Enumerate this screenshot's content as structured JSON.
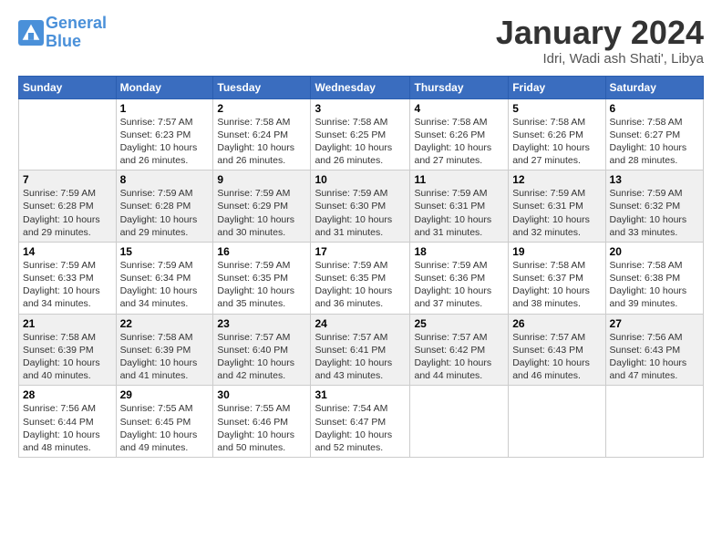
{
  "header": {
    "logo_line1": "General",
    "logo_line2": "Blue",
    "month_year": "January 2024",
    "location": "Idri, Wadi ash Shati', Libya"
  },
  "days_of_week": [
    "Sunday",
    "Monday",
    "Tuesday",
    "Wednesday",
    "Thursday",
    "Friday",
    "Saturday"
  ],
  "weeks": [
    [
      {
        "num": "",
        "info": ""
      },
      {
        "num": "1",
        "info": "Sunrise: 7:57 AM\nSunset: 6:23 PM\nDaylight: 10 hours\nand 26 minutes."
      },
      {
        "num": "2",
        "info": "Sunrise: 7:58 AM\nSunset: 6:24 PM\nDaylight: 10 hours\nand 26 minutes."
      },
      {
        "num": "3",
        "info": "Sunrise: 7:58 AM\nSunset: 6:25 PM\nDaylight: 10 hours\nand 26 minutes."
      },
      {
        "num": "4",
        "info": "Sunrise: 7:58 AM\nSunset: 6:26 PM\nDaylight: 10 hours\nand 27 minutes."
      },
      {
        "num": "5",
        "info": "Sunrise: 7:58 AM\nSunset: 6:26 PM\nDaylight: 10 hours\nand 27 minutes."
      },
      {
        "num": "6",
        "info": "Sunrise: 7:58 AM\nSunset: 6:27 PM\nDaylight: 10 hours\nand 28 minutes."
      }
    ],
    [
      {
        "num": "7",
        "info": "Sunrise: 7:59 AM\nSunset: 6:28 PM\nDaylight: 10 hours\nand 29 minutes."
      },
      {
        "num": "8",
        "info": "Sunrise: 7:59 AM\nSunset: 6:28 PM\nDaylight: 10 hours\nand 29 minutes."
      },
      {
        "num": "9",
        "info": "Sunrise: 7:59 AM\nSunset: 6:29 PM\nDaylight: 10 hours\nand 30 minutes."
      },
      {
        "num": "10",
        "info": "Sunrise: 7:59 AM\nSunset: 6:30 PM\nDaylight: 10 hours\nand 31 minutes."
      },
      {
        "num": "11",
        "info": "Sunrise: 7:59 AM\nSunset: 6:31 PM\nDaylight: 10 hours\nand 31 minutes."
      },
      {
        "num": "12",
        "info": "Sunrise: 7:59 AM\nSunset: 6:31 PM\nDaylight: 10 hours\nand 32 minutes."
      },
      {
        "num": "13",
        "info": "Sunrise: 7:59 AM\nSunset: 6:32 PM\nDaylight: 10 hours\nand 33 minutes."
      }
    ],
    [
      {
        "num": "14",
        "info": "Sunrise: 7:59 AM\nSunset: 6:33 PM\nDaylight: 10 hours\nand 34 minutes."
      },
      {
        "num": "15",
        "info": "Sunrise: 7:59 AM\nSunset: 6:34 PM\nDaylight: 10 hours\nand 34 minutes."
      },
      {
        "num": "16",
        "info": "Sunrise: 7:59 AM\nSunset: 6:35 PM\nDaylight: 10 hours\nand 35 minutes."
      },
      {
        "num": "17",
        "info": "Sunrise: 7:59 AM\nSunset: 6:35 PM\nDaylight: 10 hours\nand 36 minutes."
      },
      {
        "num": "18",
        "info": "Sunrise: 7:59 AM\nSunset: 6:36 PM\nDaylight: 10 hours\nand 37 minutes."
      },
      {
        "num": "19",
        "info": "Sunrise: 7:58 AM\nSunset: 6:37 PM\nDaylight: 10 hours\nand 38 minutes."
      },
      {
        "num": "20",
        "info": "Sunrise: 7:58 AM\nSunset: 6:38 PM\nDaylight: 10 hours\nand 39 minutes."
      }
    ],
    [
      {
        "num": "21",
        "info": "Sunrise: 7:58 AM\nSunset: 6:39 PM\nDaylight: 10 hours\nand 40 minutes."
      },
      {
        "num": "22",
        "info": "Sunrise: 7:58 AM\nSunset: 6:39 PM\nDaylight: 10 hours\nand 41 minutes."
      },
      {
        "num": "23",
        "info": "Sunrise: 7:57 AM\nSunset: 6:40 PM\nDaylight: 10 hours\nand 42 minutes."
      },
      {
        "num": "24",
        "info": "Sunrise: 7:57 AM\nSunset: 6:41 PM\nDaylight: 10 hours\nand 43 minutes."
      },
      {
        "num": "25",
        "info": "Sunrise: 7:57 AM\nSunset: 6:42 PM\nDaylight: 10 hours\nand 44 minutes."
      },
      {
        "num": "26",
        "info": "Sunrise: 7:57 AM\nSunset: 6:43 PM\nDaylight: 10 hours\nand 46 minutes."
      },
      {
        "num": "27",
        "info": "Sunrise: 7:56 AM\nSunset: 6:43 PM\nDaylight: 10 hours\nand 47 minutes."
      }
    ],
    [
      {
        "num": "28",
        "info": "Sunrise: 7:56 AM\nSunset: 6:44 PM\nDaylight: 10 hours\nand 48 minutes."
      },
      {
        "num": "29",
        "info": "Sunrise: 7:55 AM\nSunset: 6:45 PM\nDaylight: 10 hours\nand 49 minutes."
      },
      {
        "num": "30",
        "info": "Sunrise: 7:55 AM\nSunset: 6:46 PM\nDaylight: 10 hours\nand 50 minutes."
      },
      {
        "num": "31",
        "info": "Sunrise: 7:54 AM\nSunset: 6:47 PM\nDaylight: 10 hours\nand 52 minutes."
      },
      {
        "num": "",
        "info": ""
      },
      {
        "num": "",
        "info": ""
      },
      {
        "num": "",
        "info": ""
      }
    ]
  ]
}
